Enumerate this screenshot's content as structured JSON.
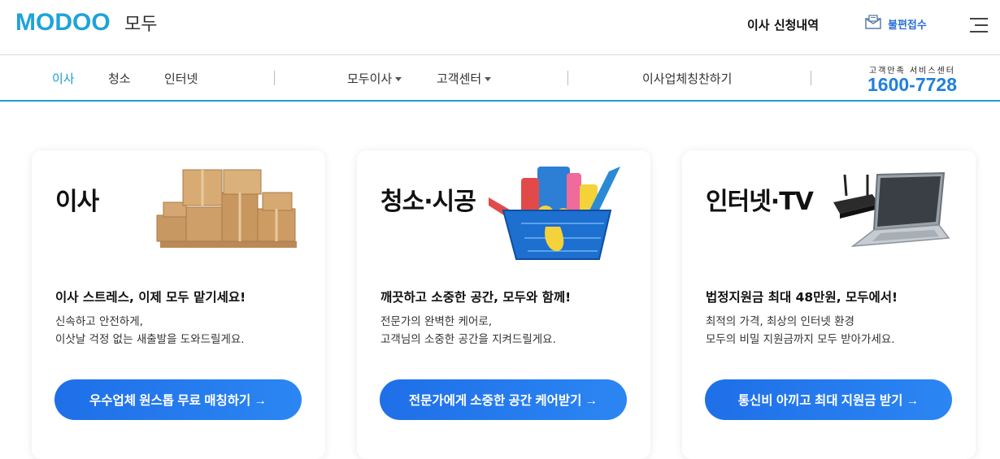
{
  "header": {
    "logo_text": "MODOO",
    "brand_kr": "모두",
    "history_link": "이사 신청내역",
    "complaint_label": "불편접수",
    "icons": {
      "complaint": "envelope-icon",
      "menu": "hamburger-menu-icon"
    }
  },
  "nav": {
    "items": [
      {
        "label": "이사",
        "active": true
      },
      {
        "label": "청소"
      },
      {
        "label": "인터넷"
      },
      {
        "label": "모두이사",
        "dropdown": true
      },
      {
        "label": "고객센터",
        "dropdown": true
      },
      {
        "label": "이사업체칭찬하기"
      }
    ],
    "cs_label": "고객만족 서비스센터",
    "cs_phone": "1600-7728",
    "accent": "#1f9bd6"
  },
  "cards": [
    {
      "title": "이사",
      "image": "moving-boxes",
      "headline": "이사 스트레스, 이제 모두 맡기세요!",
      "desc_line1": "신속하고 안전하게,",
      "desc_line2": "이삿날 걱정 없는 새출발을 도와드릴게요.",
      "button": "우수업체 원스톱 무료 매칭하기 →"
    },
    {
      "title": "청소·시공",
      "image": "cleaning-basket",
      "headline": "깨끗하고 소중한 공간, 모두와 함께!",
      "desc_line1": "전문가의 완벽한 케어로,",
      "desc_line2": "고객님의 소중한 공간을 지켜드릴게요.",
      "button": "전문가에게 소중한 공간 케어받기 →"
    },
    {
      "title": "인터넷·TV",
      "image": "router-and-laptop",
      "headline": "법정지원금 최대 48만원, 모두에서!",
      "desc_line1": "최적의 가격, 최상의 인터넷 환경",
      "desc_line2": "모두의 비밀 지원금까지 모두 받아가세요.",
      "button": "통신비 아끼고 최대 지원금 받기 →"
    }
  ],
  "colors": {
    "brand": "#1fa3d8",
    "button": "#1f6fe8",
    "phone": "#1f7fdc"
  }
}
